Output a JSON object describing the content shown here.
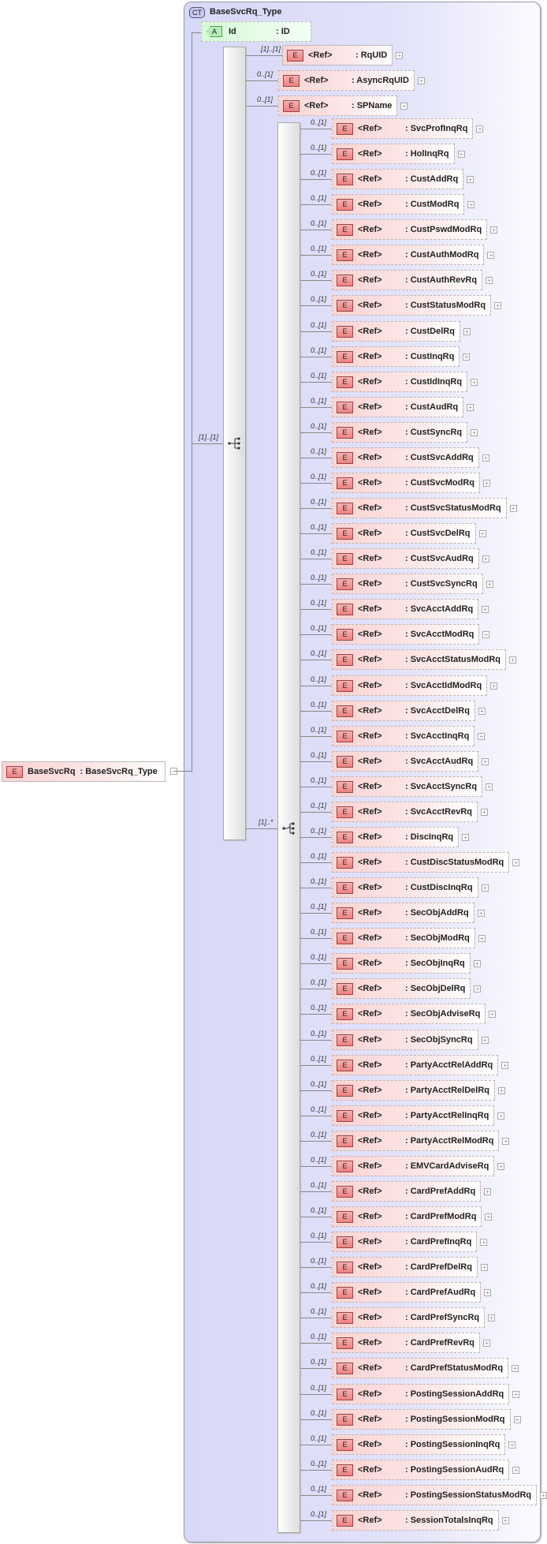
{
  "complex_type": {
    "badge": "CT",
    "name": "BaseSvcRq_Type"
  },
  "attribute": {
    "badge": "A",
    "name": "Id",
    "type": ": ID"
  },
  "root": {
    "badge": "E",
    "name": "BaseSvcRq",
    "type": ": BaseSvcRq_Type"
  },
  "sequence_multiplicity": "[1]..[1]",
  "choice_multiplicity": "[1]..*",
  "ref_label": "<Ref>",
  "sequence_items": [
    {
      "mult": "[1]..[1]",
      "name": ": RqUID",
      "optional": false
    },
    {
      "mult": "0..[1]",
      "name": ": AsyncRqUID",
      "optional": true
    },
    {
      "mult": "0..[1]",
      "name": ": SPName",
      "optional": true
    }
  ],
  "choice_mult": "0..[1]",
  "choice_items": [
    "SvcProfInqRq",
    "HolInqRq",
    "CustAddRq",
    "CustModRq",
    "CustPswdModRq",
    "CustAuthModRq",
    "CustAuthRevRq",
    "CustStatusModRq",
    "CustDelRq",
    "CustInqRq",
    "CustIdInqRq",
    "CustAudRq",
    "CustSyncRq",
    "CustSvcAddRq",
    "CustSvcModRq",
    "CustSvcStatusModRq",
    "CustSvcDelRq",
    "CustSvcAudRq",
    "CustSvcSyncRq",
    "SvcAcctAddRq",
    "SvcAcctModRq",
    "SvcAcctStatusModRq",
    "SvcAcctIdModRq",
    "SvcAcctDelRq",
    "SvcAcctInqRq",
    "SvcAcctAudRq",
    "SvcAcctSyncRq",
    "SvcAcctRevRq",
    "DiscInqRq",
    "CustDiscStatusModRq",
    "CustDiscInqRq",
    "SecObjAddRq",
    "SecObjModRq",
    "SecObjInqRq",
    "SecObjDelRq",
    "SecObjAdviseRq",
    "SecObjSyncRq",
    "PartyAcctRelAddRq",
    "PartyAcctRelDelRq",
    "PartyAcctRelInqRq",
    "PartyAcctRelModRq",
    "EMVCardAdviseRq",
    "CardPrefAddRq",
    "CardPrefModRq",
    "CardPrefInqRq",
    "CardPrefDelRq",
    "CardPrefAudRq",
    "CardPrefSyncRq",
    "CardPrefRevRq",
    "CardPrefStatusModRq",
    "PostingSessionAddRq",
    "PostingSessionModRq",
    "PostingSessionInqRq",
    "PostingSessionAudRq",
    "PostingSessionStatusModRq",
    "SessionTotalsInqRq"
  ]
}
